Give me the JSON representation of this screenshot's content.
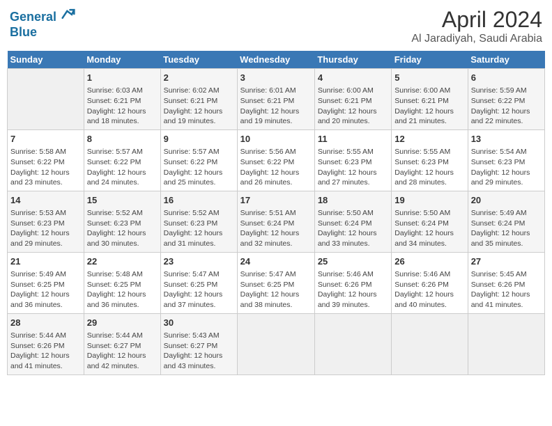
{
  "logo": {
    "line1": "General",
    "line2": "Blue"
  },
  "title": "April 2024",
  "subtitle": "Al Jaradiyah, Saudi Arabia",
  "days_of_week": [
    "Sunday",
    "Monday",
    "Tuesday",
    "Wednesday",
    "Thursday",
    "Friday",
    "Saturday"
  ],
  "weeks": [
    [
      {
        "day": "",
        "info": ""
      },
      {
        "day": "1",
        "info": "Sunrise: 6:03 AM\nSunset: 6:21 PM\nDaylight: 12 hours\nand 18 minutes."
      },
      {
        "day": "2",
        "info": "Sunrise: 6:02 AM\nSunset: 6:21 PM\nDaylight: 12 hours\nand 19 minutes."
      },
      {
        "day": "3",
        "info": "Sunrise: 6:01 AM\nSunset: 6:21 PM\nDaylight: 12 hours\nand 19 minutes."
      },
      {
        "day": "4",
        "info": "Sunrise: 6:00 AM\nSunset: 6:21 PM\nDaylight: 12 hours\nand 20 minutes."
      },
      {
        "day": "5",
        "info": "Sunrise: 6:00 AM\nSunset: 6:21 PM\nDaylight: 12 hours\nand 21 minutes."
      },
      {
        "day": "6",
        "info": "Sunrise: 5:59 AM\nSunset: 6:22 PM\nDaylight: 12 hours\nand 22 minutes."
      }
    ],
    [
      {
        "day": "7",
        "info": "Sunrise: 5:58 AM\nSunset: 6:22 PM\nDaylight: 12 hours\nand 23 minutes."
      },
      {
        "day": "8",
        "info": "Sunrise: 5:57 AM\nSunset: 6:22 PM\nDaylight: 12 hours\nand 24 minutes."
      },
      {
        "day": "9",
        "info": "Sunrise: 5:57 AM\nSunset: 6:22 PM\nDaylight: 12 hours\nand 25 minutes."
      },
      {
        "day": "10",
        "info": "Sunrise: 5:56 AM\nSunset: 6:22 PM\nDaylight: 12 hours\nand 26 minutes."
      },
      {
        "day": "11",
        "info": "Sunrise: 5:55 AM\nSunset: 6:23 PM\nDaylight: 12 hours\nand 27 minutes."
      },
      {
        "day": "12",
        "info": "Sunrise: 5:55 AM\nSunset: 6:23 PM\nDaylight: 12 hours\nand 28 minutes."
      },
      {
        "day": "13",
        "info": "Sunrise: 5:54 AM\nSunset: 6:23 PM\nDaylight: 12 hours\nand 29 minutes."
      }
    ],
    [
      {
        "day": "14",
        "info": "Sunrise: 5:53 AM\nSunset: 6:23 PM\nDaylight: 12 hours\nand 29 minutes."
      },
      {
        "day": "15",
        "info": "Sunrise: 5:52 AM\nSunset: 6:23 PM\nDaylight: 12 hours\nand 30 minutes."
      },
      {
        "day": "16",
        "info": "Sunrise: 5:52 AM\nSunset: 6:23 PM\nDaylight: 12 hours\nand 31 minutes."
      },
      {
        "day": "17",
        "info": "Sunrise: 5:51 AM\nSunset: 6:24 PM\nDaylight: 12 hours\nand 32 minutes."
      },
      {
        "day": "18",
        "info": "Sunrise: 5:50 AM\nSunset: 6:24 PM\nDaylight: 12 hours\nand 33 minutes."
      },
      {
        "day": "19",
        "info": "Sunrise: 5:50 AM\nSunset: 6:24 PM\nDaylight: 12 hours\nand 34 minutes."
      },
      {
        "day": "20",
        "info": "Sunrise: 5:49 AM\nSunset: 6:24 PM\nDaylight: 12 hours\nand 35 minutes."
      }
    ],
    [
      {
        "day": "21",
        "info": "Sunrise: 5:49 AM\nSunset: 6:25 PM\nDaylight: 12 hours\nand 36 minutes."
      },
      {
        "day": "22",
        "info": "Sunrise: 5:48 AM\nSunset: 6:25 PM\nDaylight: 12 hours\nand 36 minutes."
      },
      {
        "day": "23",
        "info": "Sunrise: 5:47 AM\nSunset: 6:25 PM\nDaylight: 12 hours\nand 37 minutes."
      },
      {
        "day": "24",
        "info": "Sunrise: 5:47 AM\nSunset: 6:25 PM\nDaylight: 12 hours\nand 38 minutes."
      },
      {
        "day": "25",
        "info": "Sunrise: 5:46 AM\nSunset: 6:26 PM\nDaylight: 12 hours\nand 39 minutes."
      },
      {
        "day": "26",
        "info": "Sunrise: 5:46 AM\nSunset: 6:26 PM\nDaylight: 12 hours\nand 40 minutes."
      },
      {
        "day": "27",
        "info": "Sunrise: 5:45 AM\nSunset: 6:26 PM\nDaylight: 12 hours\nand 41 minutes."
      }
    ],
    [
      {
        "day": "28",
        "info": "Sunrise: 5:44 AM\nSunset: 6:26 PM\nDaylight: 12 hours\nand 41 minutes."
      },
      {
        "day": "29",
        "info": "Sunrise: 5:44 AM\nSunset: 6:27 PM\nDaylight: 12 hours\nand 42 minutes."
      },
      {
        "day": "30",
        "info": "Sunrise: 5:43 AM\nSunset: 6:27 PM\nDaylight: 12 hours\nand 43 minutes."
      },
      {
        "day": "",
        "info": ""
      },
      {
        "day": "",
        "info": ""
      },
      {
        "day": "",
        "info": ""
      },
      {
        "day": "",
        "info": ""
      }
    ]
  ]
}
